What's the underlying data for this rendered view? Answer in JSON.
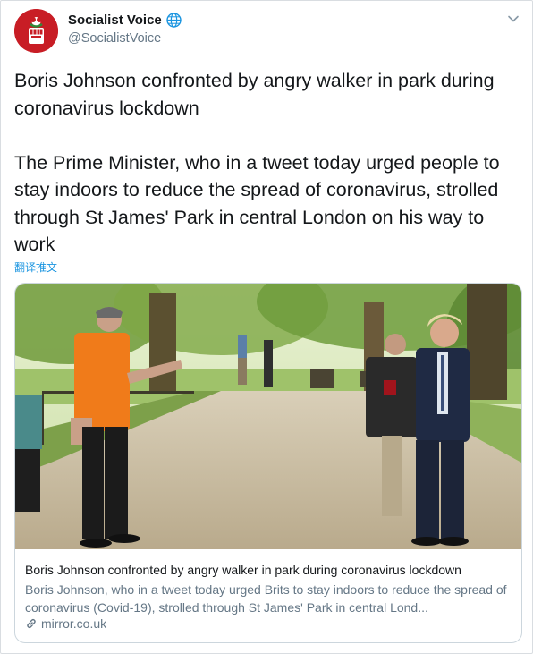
{
  "account": {
    "display_name": "Socialist Voice",
    "handle": "@SocialistVoice"
  },
  "tweet": {
    "text": "Boris Johnson confronted by angry walker in park during coronavirus lockdown\n\nThe Prime Minister, who in a tweet today urged people to stay indoors to reduce the spread of coronavirus, strolled through St James' Park in central London on his way to work",
    "translate_label": "翻译推文"
  },
  "card": {
    "title": "Boris Johnson confronted by angry walker in park during coronavirus lockdown",
    "description": "Boris Johnson, who in a tweet today urged Brits to stay indoors to reduce the spread of coronavirus (Covid-19), strolled through St James' Park in central Lond...",
    "domain": "mirror.co.uk"
  },
  "icons": {
    "avatar": "rose-fist-logo",
    "verified_globe": "globe-icon",
    "menu": "chevron-down-icon",
    "card_link": "link-icon"
  },
  "colors": {
    "brand_red": "#c81d25",
    "link_blue": "#1b95e0",
    "secondary_text": "#657786"
  }
}
